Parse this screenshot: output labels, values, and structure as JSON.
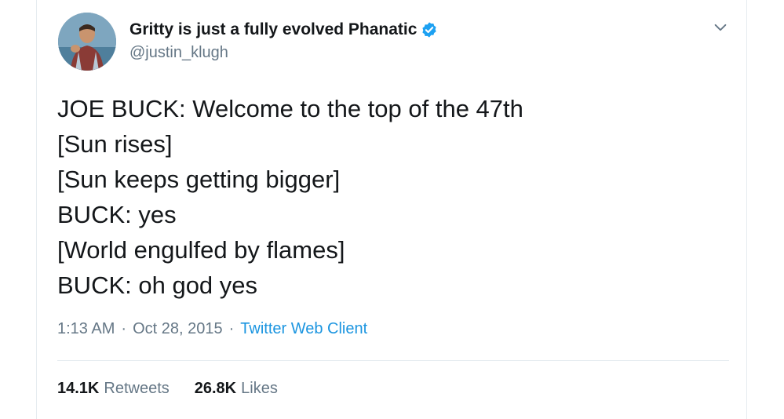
{
  "author": {
    "display_name": "Gritty is just a fully evolved Phanatic",
    "handle": "@justin_klugh",
    "verified": true
  },
  "tweet": {
    "lines": [
      "JOE BUCK: Welcome to the top of the 47th",
      "[Sun rises]",
      "[Sun keeps getting bigger]",
      "BUCK: yes",
      "[World engulfed by flames]",
      "BUCK: oh god yes"
    ],
    "time": "1:13 AM",
    "separator": "·",
    "date": "Oct 28, 2015",
    "client": "Twitter Web Client"
  },
  "stats": {
    "retweets_count": "14.1K",
    "retweets_label": "Retweets",
    "likes_count": "26.8K",
    "likes_label": "Likes"
  },
  "icons": {
    "verified": "verified-badge-icon",
    "menu": "chevron-down-icon"
  },
  "colors": {
    "text": "#14171a",
    "secondary": "#657786",
    "link": "#1b95e0",
    "verified": "#1da1f2",
    "divider": "#e6ecf0"
  }
}
